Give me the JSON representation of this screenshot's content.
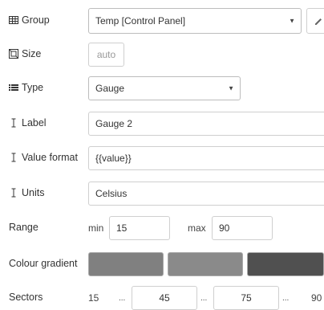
{
  "group": {
    "label": "Group",
    "value": "Temp [Control Panel]",
    "edit_icon": "pencil-icon",
    "icon": "table-icon"
  },
  "size": {
    "label": "Size",
    "value": "auto",
    "icon": "resize-icon"
  },
  "type": {
    "label": "Type",
    "value": "Gauge",
    "icon": "list-icon"
  },
  "label_field": {
    "label": "Label",
    "value": "Gauge 2",
    "icon": "text-cursor-icon"
  },
  "value_format": {
    "label": "Value format",
    "value": "{{value}}",
    "icon": "text-cursor-icon"
  },
  "units": {
    "label": "Units",
    "value": "Celsius",
    "icon": "text-cursor-icon"
  },
  "range": {
    "label": "Range",
    "min_label": "min",
    "min": "15",
    "max_label": "max",
    "max": "90"
  },
  "colour_gradient": {
    "label": "Colour gradient",
    "colors": [
      "#808080",
      "#8a8a8a",
      "#505050"
    ]
  },
  "sectors": {
    "label": "Sectors",
    "start": "15",
    "sep": "...",
    "v1": "45",
    "v2": "75",
    "end": "90"
  }
}
